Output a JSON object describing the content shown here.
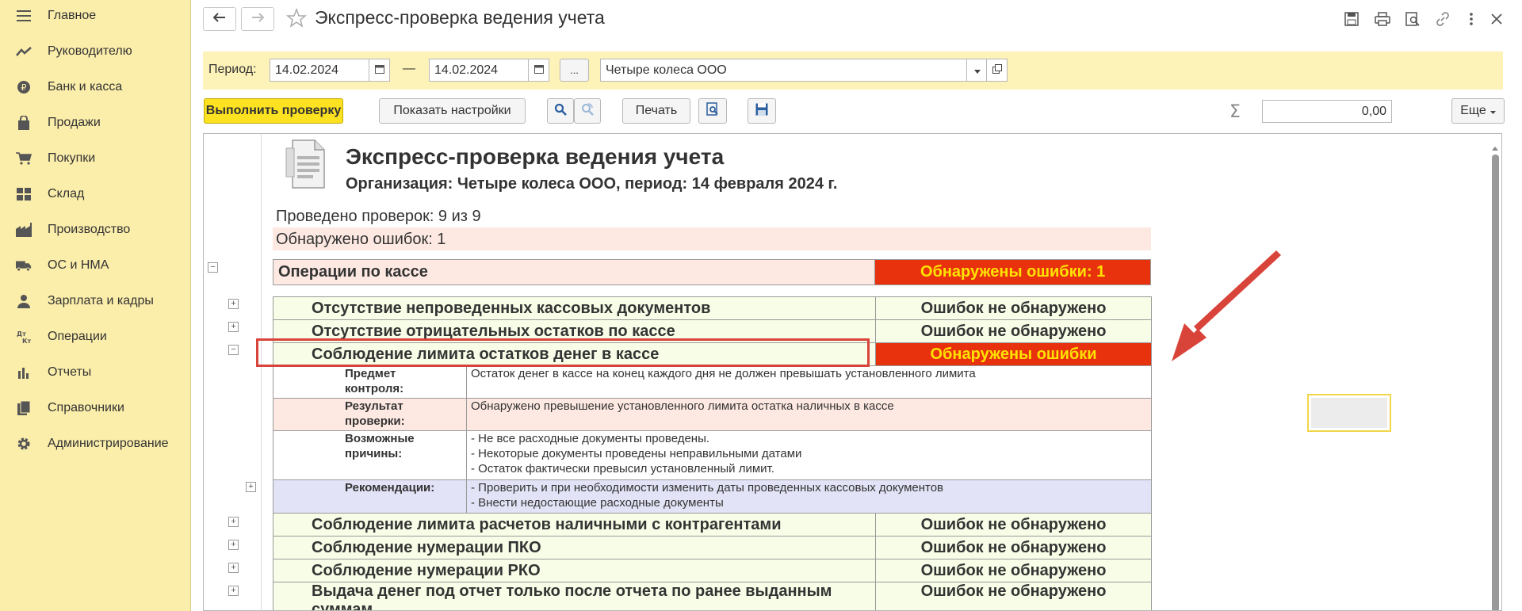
{
  "sidebar": {
    "items": [
      {
        "label": "Главное",
        "icon": "menu-icon"
      },
      {
        "label": "Руководителю",
        "icon": "trend-icon"
      },
      {
        "label": "Банк и касса",
        "icon": "ruble-coin-icon"
      },
      {
        "label": "Продажи",
        "icon": "shopping-bag-icon"
      },
      {
        "label": "Покупки",
        "icon": "cart-icon"
      },
      {
        "label": "Склад",
        "icon": "warehouse-icon"
      },
      {
        "label": "Производство",
        "icon": "factory-icon"
      },
      {
        "label": "ОС и НМА",
        "icon": "truck-icon"
      },
      {
        "label": "Зарплата и кадры",
        "icon": "person-icon"
      },
      {
        "label": "Операции",
        "icon": "debit-credit-icon"
      },
      {
        "label": "Отчеты",
        "icon": "bar-chart-icon"
      },
      {
        "label": "Справочники",
        "icon": "books-icon"
      },
      {
        "label": "Администрирование",
        "icon": "gear-icon"
      }
    ]
  },
  "header": {
    "title": "Экспресс-проверка ведения учета"
  },
  "filters": {
    "period_label": "Период:",
    "date_from": "14.02.2024",
    "separator": "—",
    "date_to": "14.02.2024",
    "more_label": "...",
    "organization": "Четыре колеса ООО"
  },
  "toolbar": {
    "run_label": "Выполнить проверку",
    "settings_label": "Показать настройки",
    "print_label": "Печать",
    "sum_symbol": "Σ",
    "sum_value": "0,00",
    "more_label": "Еще"
  },
  "report": {
    "title": "Экспресс-проверка ведения учета",
    "subtitle": "Организация: Четыре колеса ООО, период: 14 февраля 2024 г.",
    "checks_done": "Проведено проверок: 9 из 9",
    "errors_found": "Обнаружено ошибок: 1",
    "group": {
      "name": "Операции по кассе",
      "status": "Обнаружены ошибки: 1"
    },
    "rows": [
      {
        "name": "Отсутствие непроведенных кассовых документов",
        "status": "Ошибок не обнаружено"
      },
      {
        "name": "Отсутствие отрицательных остатков по кассе",
        "status": "Ошибок не обнаружено"
      },
      {
        "name": "Соблюдение лимита остатков денег в кассе",
        "status": "Обнаружены ошибки"
      }
    ],
    "details": {
      "subject_label": "Предмет контроля:",
      "subject_value": "Остаток денег в кассе на конец каждого дня не должен превышать установленного лимита",
      "result_label": "Результат проверки:",
      "result_value": "Обнаружено превышение установленного лимита остатка наличных в кассе",
      "causes_label": "Возможные причины:",
      "causes": [
        "- Не все расходные документы проведены.",
        "- Некоторые документы проведены неправильными датами",
        "- Остаток фактически превысил установленный лимит."
      ],
      "recommend_label": "Рекомендации:",
      "recommendations": [
        "- Проверить и при необходимости изменить даты проведенных кассовых документов",
        "- Внести недостающие расходные документы"
      ]
    },
    "rows_after": [
      {
        "name": "Соблюдение лимита расчетов наличными с контрагентами",
        "status": "Ошибок не обнаружено"
      },
      {
        "name": "Соблюдение нумерации ПКО",
        "status": "Ошибок не обнаружено"
      },
      {
        "name": "Соблюдение нумерации РКО",
        "status": "Ошибок не обнаружено"
      },
      {
        "name": "Выдача денег под отчет только после отчета по ранее выданным суммам",
        "status": "Ошибок не обнаружено"
      }
    ]
  },
  "colors": {
    "sidebar_bg": "#fbedaa",
    "filter_bg": "#fdf2b8",
    "primary_button": "#fce220",
    "error_red": "#e8320e",
    "error_text": "#ffe200",
    "annotation_red": "#d9443a"
  }
}
